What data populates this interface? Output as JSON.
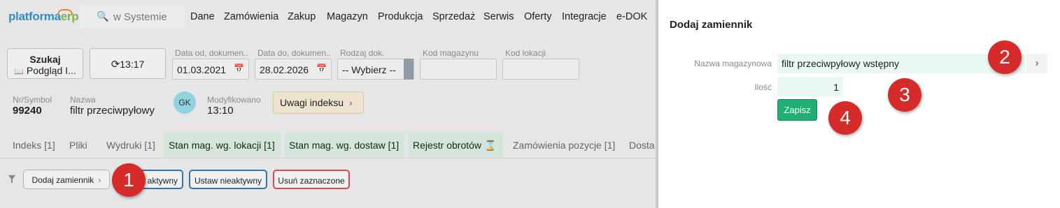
{
  "logo": {
    "part1": "platforma",
    "part2": "erp"
  },
  "search": {
    "label": "w Systemie"
  },
  "menu": [
    "Dane",
    "Zamówienia",
    "Zakup",
    "Magazyn",
    "Produkcja",
    "Sprzedaż",
    "Serwis",
    "Oferty",
    "Integracje",
    "e-DOK"
  ],
  "toolbar": {
    "search_btn_line1": "Szukaj",
    "search_btn_line2": "Podgląd I...",
    "refresh_label": "13:17",
    "date_from_label": "Data od, dokumen...",
    "date_from_value": "01.03.2021",
    "date_to_label": "Data do, dokumen...",
    "date_to_value": "28.02.2026",
    "doc_type_label": "Rodzaj dok.",
    "doc_type_value": "-- Wybierz --",
    "warehouse_code_label": "Kod magazynu",
    "location_code_label": "Kod lokacji"
  },
  "item": {
    "symbol_label": "Nr/Symbol",
    "symbol_value": "99240",
    "name_label": "Nazwa",
    "name_value": "filtr przeciwpyłowy",
    "avatar": "GK",
    "modified_label": "Modyfikowano",
    "modified_value": "13:10",
    "notes_btn": "Uwagi indeksu"
  },
  "tabs": [
    "Indeks [1]",
    "Pliki",
    "Wydruki [1]",
    "Stan mag. wg. lokacji [1]",
    "Stan mag. wg. dostaw [1]",
    "Rejestr obrotów",
    "Zamówienia pozycje [1]",
    "Dosta"
  ],
  "actions": {
    "add_substitute": "Dodaj zamiennik",
    "set_active_partial": "aktywny",
    "set_inactive": "Ustaw nieaktywny",
    "delete_selected": "Usuń zaznaczone"
  },
  "panel": {
    "title": "Dodaj zamiennik",
    "warehouse_name_label": "Nazwa magazynowa",
    "warehouse_name_value": "filtr przeciwpyłowy wstępny",
    "qty_label": "Ilość",
    "qty_value": "1",
    "save_label": "Zapisz"
  },
  "markers": [
    "1",
    "2",
    "3",
    "4"
  ],
  "colors": {
    "accent_green": "#1fae74",
    "marker_red": "#d62b2b",
    "logo_blue": "#2f8fc6",
    "logo_green": "#7ab648"
  }
}
